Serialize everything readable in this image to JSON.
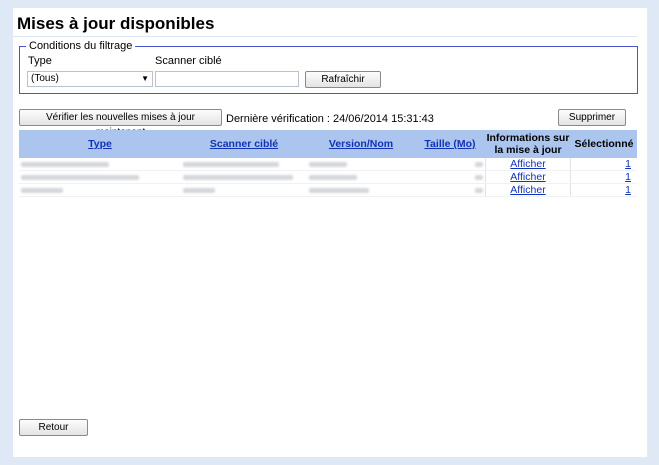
{
  "header": {
    "title": "Mises à jour disponibles"
  },
  "filter": {
    "legend": "Conditions du filtrage",
    "type_label": "Type",
    "scanner_label": "Scanner ciblé",
    "type_value": "(Tous)",
    "scanner_value": "",
    "refresh_label": "Rafraîchir"
  },
  "toolbar": {
    "check_label": "Vérifier les nouvelles mises à jour maintenant",
    "last_check": "Dernière vérification : 24/06/2014 15:31:43",
    "delete_label": "Supprimer"
  },
  "table": {
    "headers": [
      "Type",
      "Scanner ciblé",
      "Version/Nom",
      "Taille (Mo)",
      "Informations sur la mise à jour",
      "Sélectionné"
    ],
    "rows": [
      {
        "info": "Afficher",
        "selected": "1"
      },
      {
        "info": "Afficher",
        "selected": "1"
      },
      {
        "info": "Afficher",
        "selected": "1"
      }
    ]
  },
  "footer": {
    "back_label": "Retour"
  }
}
